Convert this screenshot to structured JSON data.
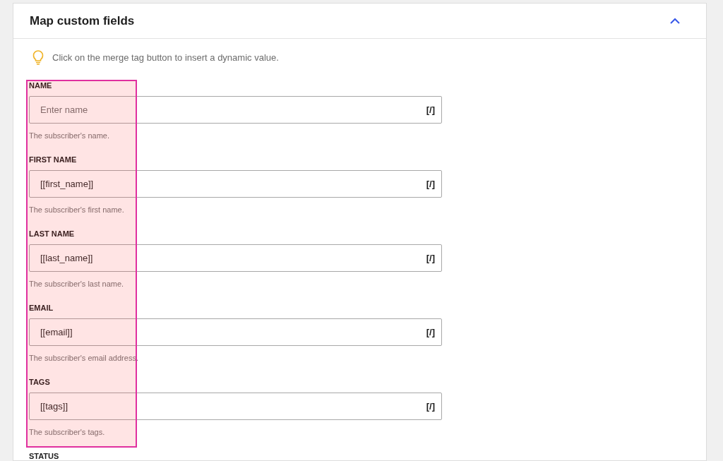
{
  "panel": {
    "title": "Map custom fields",
    "expanded": true
  },
  "tip": "Click on the merge tag button to insert a dynamic value.",
  "fields": [
    {
      "label": "NAME",
      "placeholder": "Enter name",
      "help": "The subscriber's name.",
      "merge_tag": "[/]"
    },
    {
      "label": "FIRST NAME",
      "value": "[[first_name]]",
      "help": "The subscriber's first name.",
      "merge_tag": "[/]"
    },
    {
      "label": "LAST NAME",
      "value": "[[last_name]]",
      "help": "The subscriber's last name.",
      "merge_tag": "[/]"
    },
    {
      "label": "EMAIL",
      "value": "[[email]]",
      "help": "The subscriber's email address.",
      "merge_tag": "[/]"
    },
    {
      "label": "TAGS",
      "value": "[[tags]]",
      "help": "The subscriber's tags.",
      "merge_tag": "[/]"
    },
    {
      "label": "STATUS"
    }
  ]
}
